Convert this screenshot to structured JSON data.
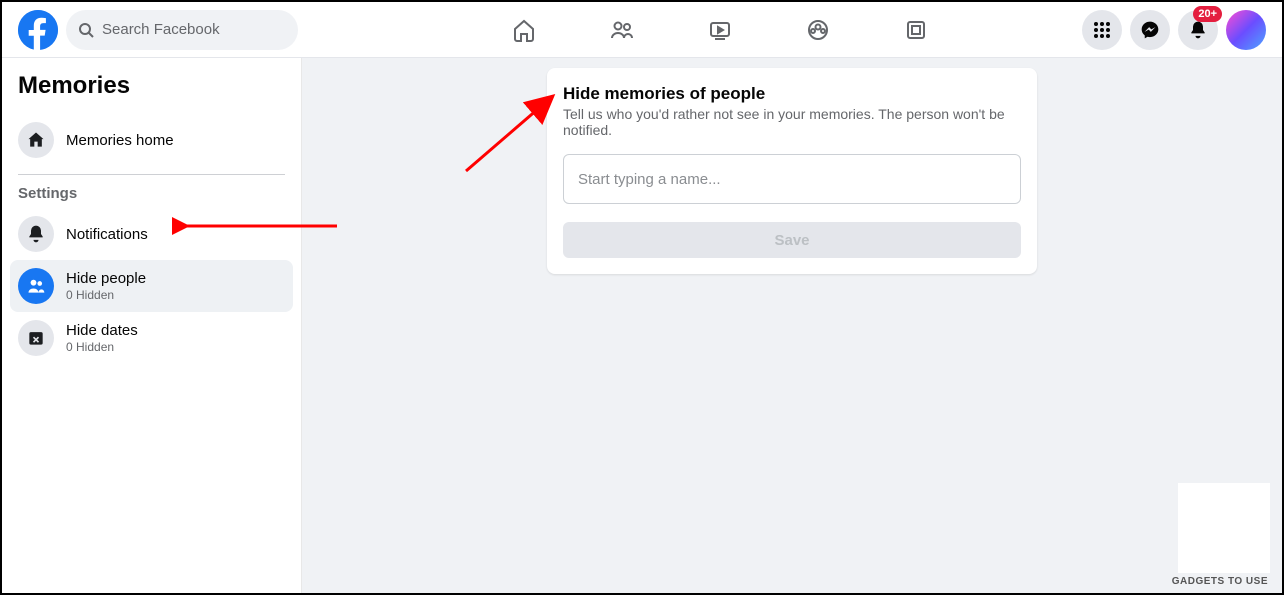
{
  "search": {
    "placeholder": "Search Facebook"
  },
  "notifBadge": "20+",
  "sidebar": {
    "title": "Memories",
    "home": "Memories home",
    "settingsLabel": "Settings",
    "items": [
      {
        "label": "Notifications"
      },
      {
        "label": "Hide people",
        "sub": "0 Hidden"
      },
      {
        "label": "Hide dates",
        "sub": "0 Hidden"
      }
    ]
  },
  "card": {
    "title": "Hide memories of people",
    "desc": "Tell us who you'd rather not see in your memories. The person won't be notified.",
    "placeholder": "Start typing a name...",
    "save": "Save"
  },
  "watermark": "GADGETS TO USE"
}
